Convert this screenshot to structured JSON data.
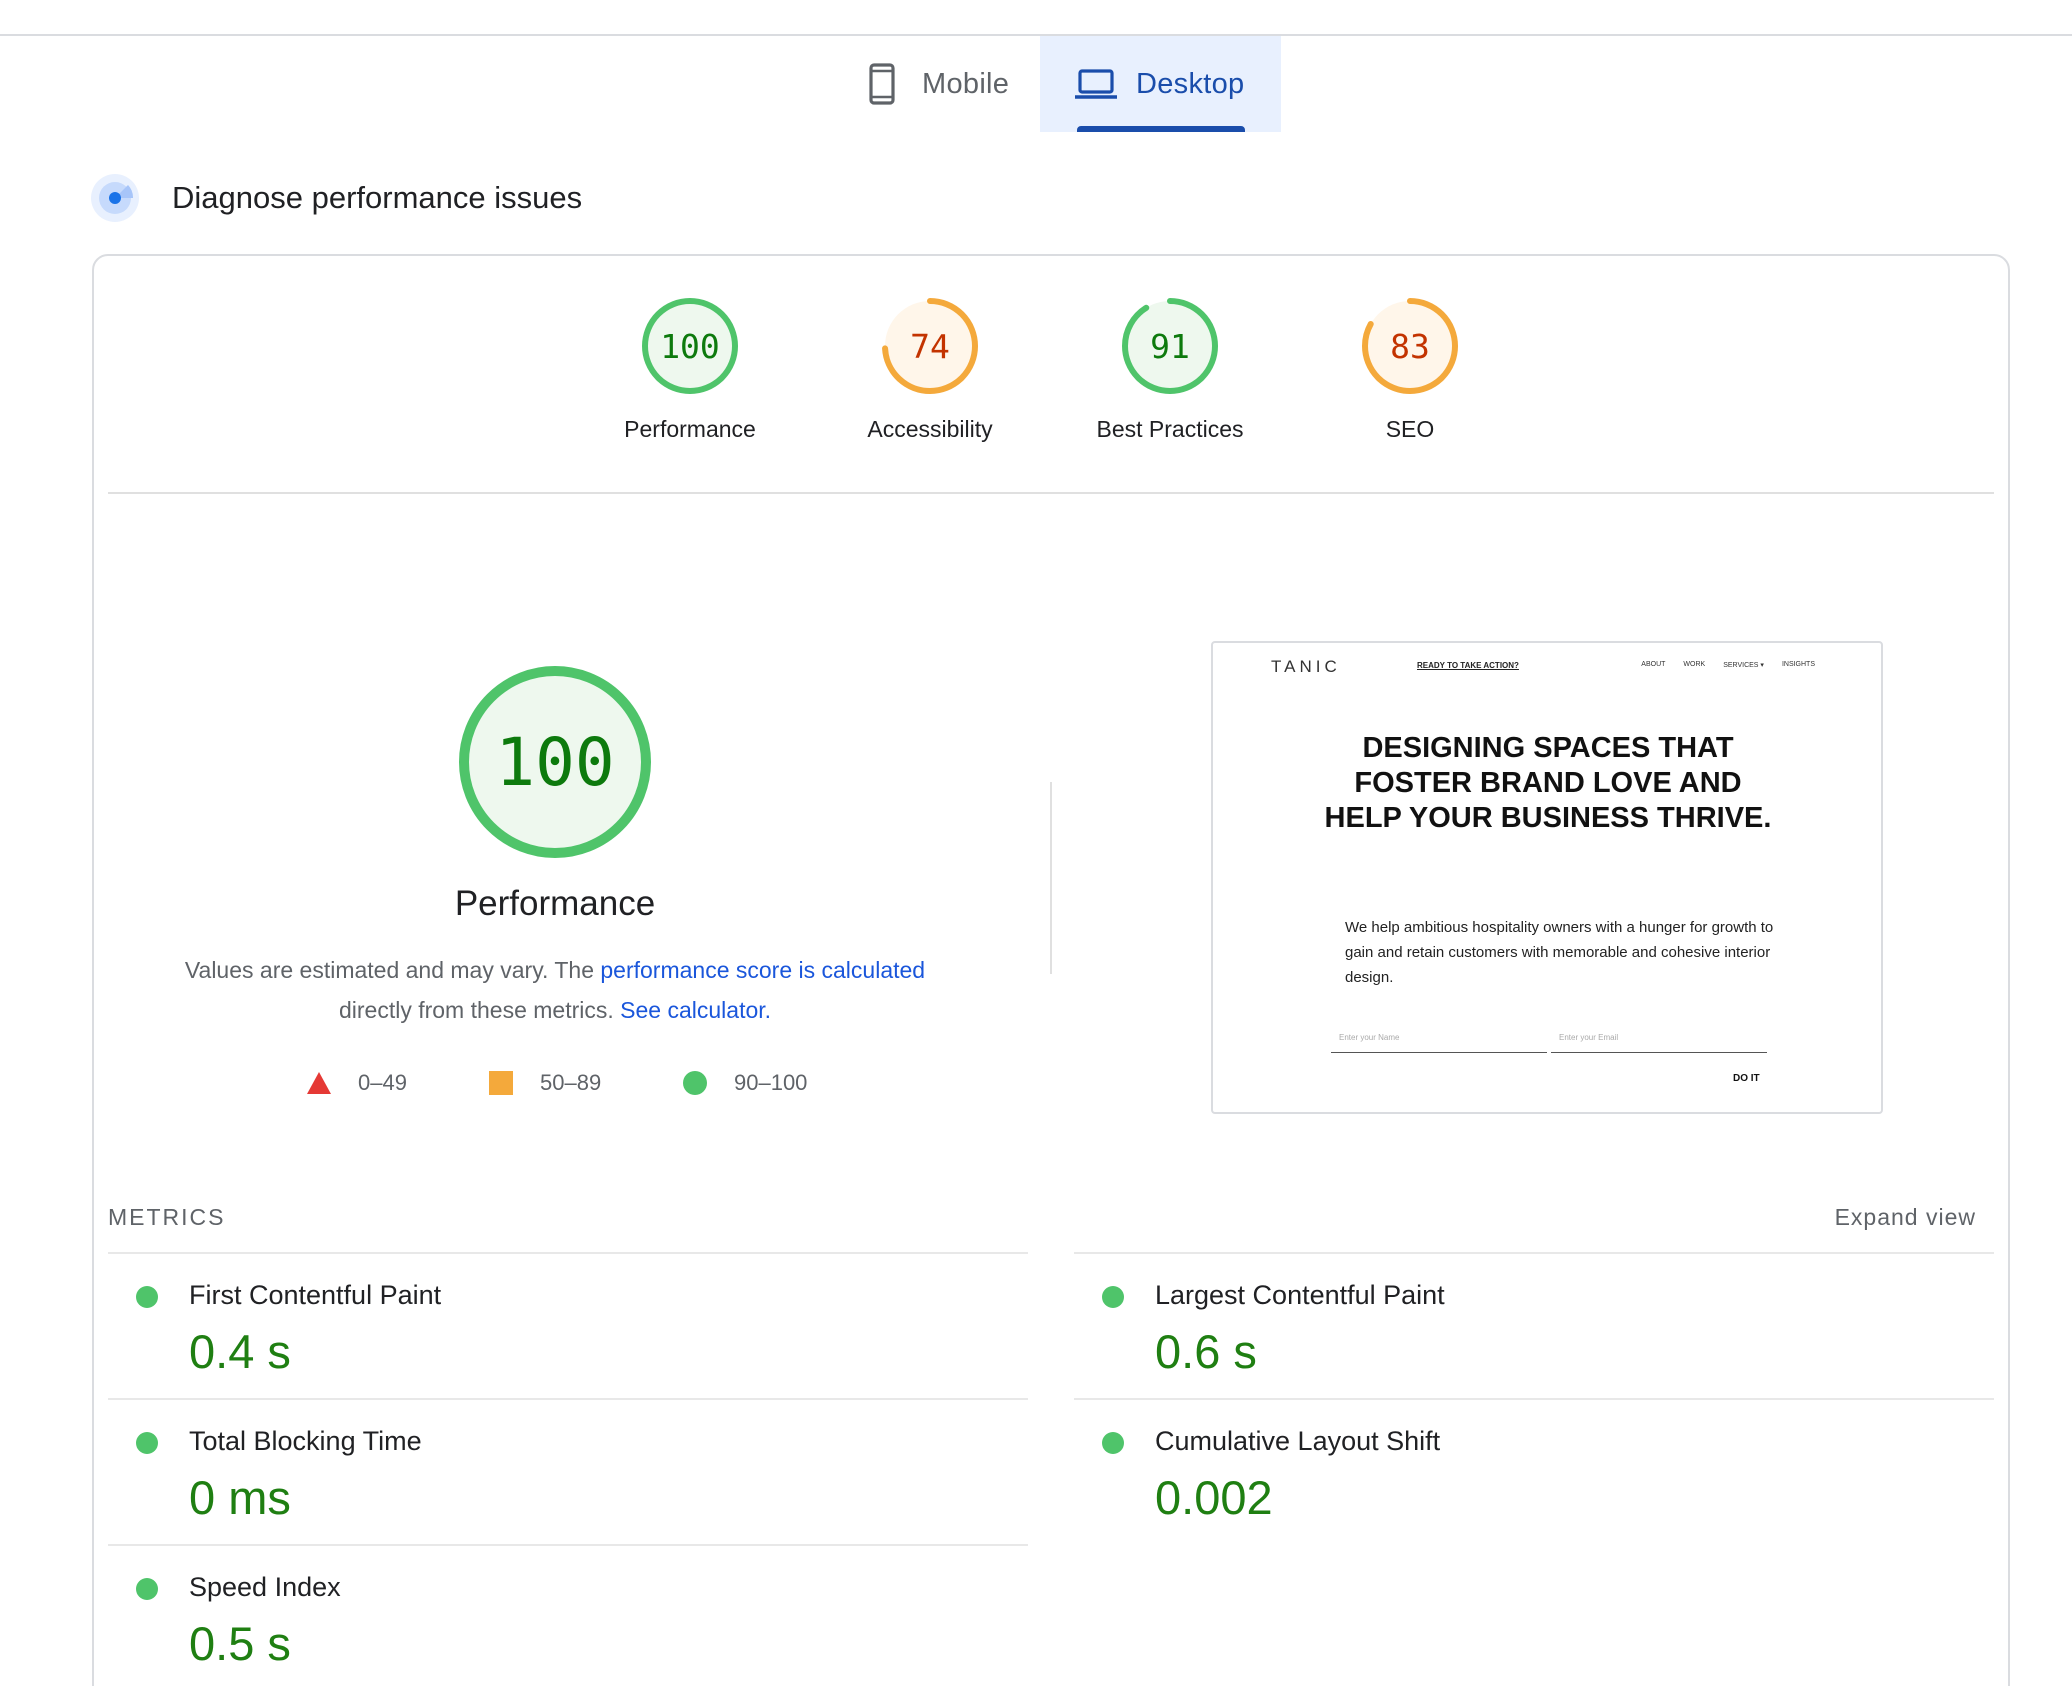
{
  "tabs": [
    {
      "label": "Mobile",
      "icon": "smartphone-icon",
      "selected": false
    },
    {
      "label": "Desktop",
      "icon": "laptop-icon",
      "selected": true
    }
  ],
  "section": {
    "title": "Diagnose performance issues",
    "icon": "radar-icon"
  },
  "categories": [
    {
      "label": "Performance",
      "score": "100",
      "score_value": 100,
      "status": "pass"
    },
    {
      "label": "Accessibility",
      "score": "74",
      "score_value": 74,
      "status": "average"
    },
    {
      "label": "Best Practices",
      "score": "91",
      "score_value": 91,
      "status": "pass"
    },
    {
      "label": "SEO",
      "score": "83",
      "score_value": 83,
      "status": "average"
    }
  ],
  "performance": {
    "score": "100",
    "score_value": 100,
    "title": "Performance",
    "desc_prefix": "Values are estimated and may vary. The ",
    "desc_link1": "performance score is calculated",
    "desc_middle": " directly from these metrics. ",
    "desc_link2": "See calculator."
  },
  "legend": [
    {
      "range": "0–49",
      "shape": "triangle-icon",
      "color": "#e53935"
    },
    {
      "range": "50–89",
      "shape": "square-icon",
      "color": "#f4a93b"
    },
    {
      "range": "90–100",
      "shape": "circle-icon",
      "color": "#4fc46a"
    }
  ],
  "screenshot": {
    "logo": "TANIC",
    "cta": "READY TO TAKE ACTION?",
    "nav": [
      "ABOUT",
      "WORK",
      "SERVICES ▾",
      "INSIGHTS"
    ],
    "headline": "DESIGNING SPACES THAT FOSTER BRAND LOVE AND HELP YOUR BUSINESS THRIVE.",
    "body": "We help ambitious hospitality owners with a hunger for growth to gain and retain customers with memorable and cohesive interior design.",
    "name_placeholder": "Enter your Name",
    "email_placeholder": "Enter your Email",
    "button": "DO IT"
  },
  "metrics": {
    "header": "METRICS",
    "expand_label": "Expand view",
    "items": [
      {
        "label": "First Contentful Paint",
        "value": "0.4 s"
      },
      {
        "label": "Largest Contentful Paint",
        "value": "0.6 s"
      },
      {
        "label": "Total Blocking Time",
        "value": "0 ms"
      },
      {
        "label": "Cumulative Layout Shift",
        "value": "0.002"
      },
      {
        "label": "Speed Index",
        "value": "0.5 s"
      }
    ]
  },
  "colors": {
    "pass": "#0cce6b",
    "pass_ring": "#4fc46a",
    "pass_text": "#0d7a0d",
    "pass_fill": "#eef8ee",
    "average_ring": "#f4a93b",
    "average_text": "#c33300",
    "average_fill": "#fff6ea",
    "accent_blue": "#1a4dab",
    "link": "#1a56db"
  }
}
